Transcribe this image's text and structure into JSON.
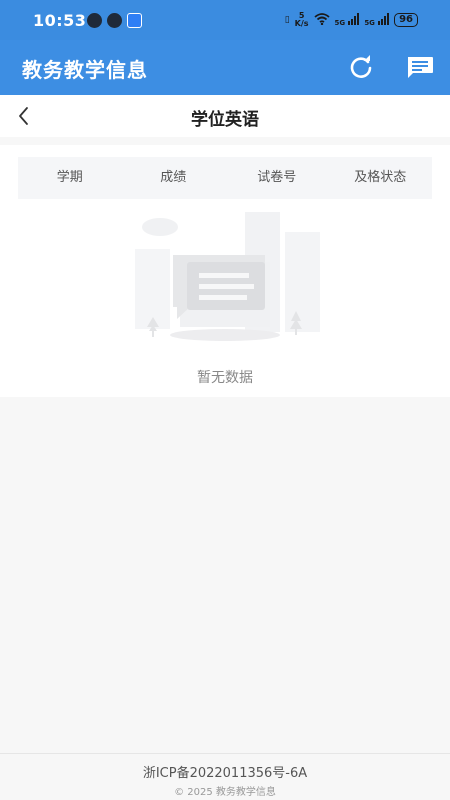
{
  "status_bar": {
    "time": "10:53",
    "network_speed_top": "5",
    "network_speed_unit": "K/s",
    "sig1_label": "5G",
    "sig2_label": "5G",
    "battery": "96"
  },
  "app_bar": {
    "title": "教务教学信息",
    "refresh_icon": "refresh-icon",
    "message_icon": "message-icon"
  },
  "page": {
    "title": "学位英语"
  },
  "table": {
    "columns": [
      "学期",
      "成绩",
      "试卷号",
      "及格状态"
    ]
  },
  "empty_state": {
    "text": "暂无数据"
  },
  "footer": {
    "icp": "浙ICP备2022011356号-6A",
    "copyright": "© 2025 教务教学信息"
  },
  "colors": {
    "primary": "#3d8ee3",
    "background": "#f7f7f7"
  }
}
